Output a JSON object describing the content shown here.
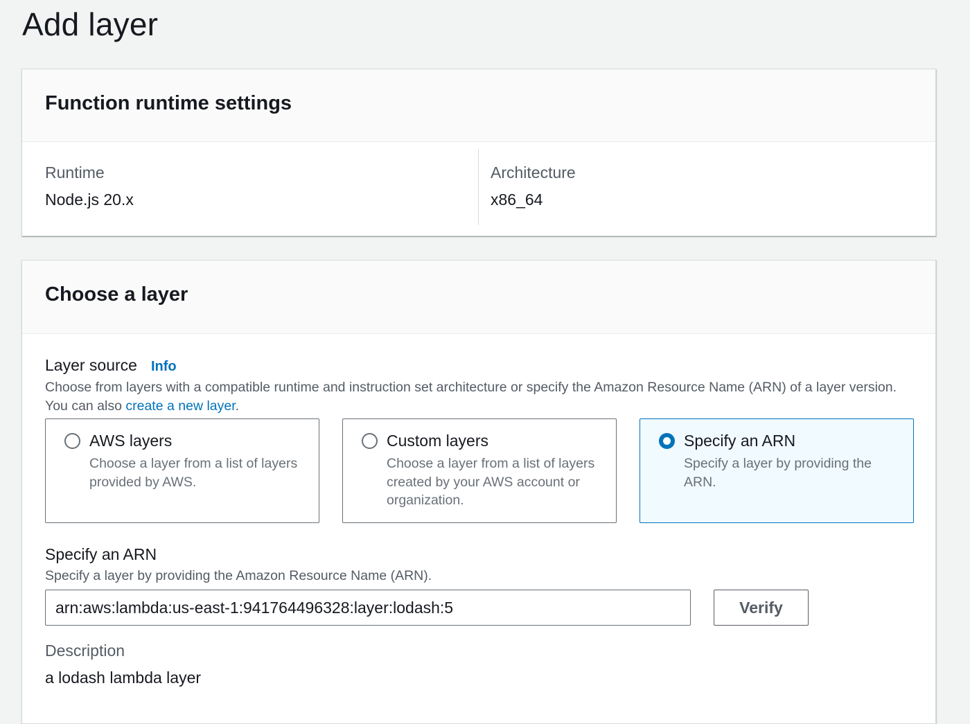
{
  "page": {
    "title": "Add layer"
  },
  "runtime_settings": {
    "heading": "Function runtime settings",
    "runtime_label": "Runtime",
    "runtime_value": "Node.js 20.x",
    "architecture_label": "Architecture",
    "architecture_value": "x86_64"
  },
  "choose_layer": {
    "heading": "Choose a layer",
    "layer_source_label": "Layer source",
    "info_link": "Info",
    "description_text": "Choose from layers with a compatible runtime and instruction set architecture or specify the Amazon Resource Name (ARN) of a layer version. You can also ",
    "create_link": "create a new layer",
    "description_end": ".",
    "options": [
      {
        "title": "AWS layers",
        "subtitle": "Choose a layer from a list of layers provided by AWS.",
        "selected": false
      },
      {
        "title": "Custom layers",
        "subtitle": "Choose a layer from a list of layers created by your AWS account or organization.",
        "selected": false
      },
      {
        "title": "Specify an ARN",
        "subtitle": "Specify a layer by providing the ARN.",
        "selected": true
      }
    ],
    "arn_field": {
      "label": "Specify an ARN",
      "description": "Specify a layer by providing the Amazon Resource Name (ARN).",
      "value": "arn:aws:lambda:us-east-1:941764496328:layer:lodash:5"
    },
    "verify_button": "Verify",
    "layer_description_label": "Description",
    "layer_description_value": "a lodash lambda layer"
  },
  "colors": {
    "link": "#0073bb",
    "selected_bg": "#f1faff",
    "page_bg": "#f2f3f3"
  }
}
